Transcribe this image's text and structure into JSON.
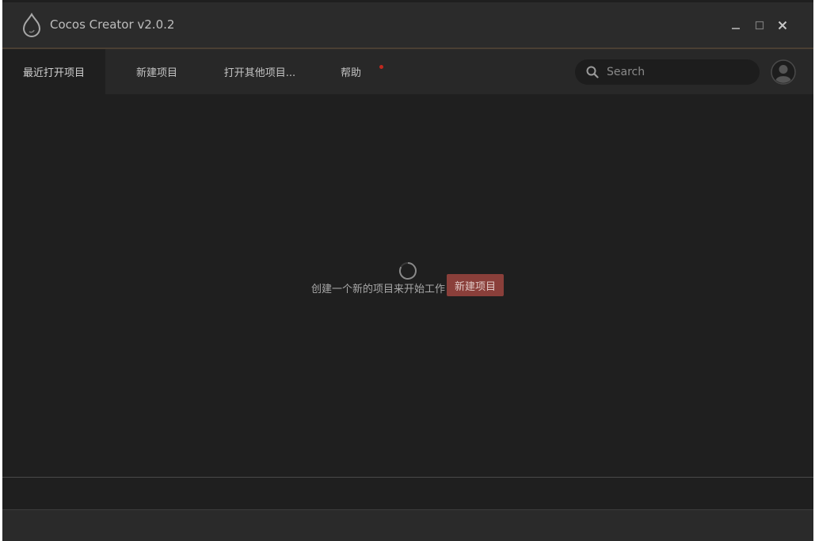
{
  "window": {
    "title": "Cocos Creator v2.0.2",
    "controls": {
      "minimize_icon": "minimize-icon",
      "maximize_icon": "maximize-icon",
      "close_icon": "close-icon"
    }
  },
  "nav": {
    "tabs": [
      {
        "label": "最近打开项目",
        "active": true
      },
      {
        "label": "新建项目",
        "active": false
      },
      {
        "label": "打开其他项目...",
        "active": false
      },
      {
        "label": "帮助",
        "active": false,
        "notification": true
      }
    ],
    "search": {
      "placeholder": "Search",
      "value": ""
    }
  },
  "main": {
    "empty_message": "创建一个新的项目来开始工作",
    "new_project_label": "新建项目"
  },
  "colors": {
    "accent_button": "#8a3f3a",
    "notification_dot": "#c0281e",
    "background": "#1f1f1f"
  }
}
